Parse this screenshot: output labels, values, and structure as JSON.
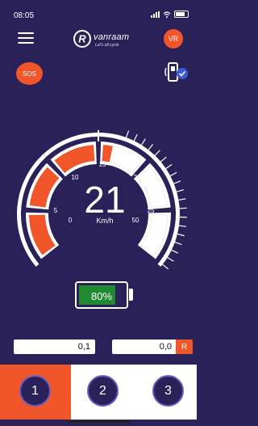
{
  "status": {
    "time": "08:05"
  },
  "header": {
    "brand": "vanraam",
    "tagline": "Let's all cycle",
    "avatar_initials": "VR"
  },
  "actions": {
    "sos_label": "SOS"
  },
  "gauge": {
    "speed": "21",
    "unit": "Km/h",
    "ticks": [
      "0",
      "5",
      "10",
      "15",
      "20",
      "25",
      "50"
    ],
    "speed_value": 21,
    "accent_color": "#f1552a"
  },
  "battery": {
    "percent_label": "80%",
    "level": 0.8,
    "fill_color": "#1f8a2f"
  },
  "odometers": {
    "left_value": "0,1",
    "right_value": "0,0",
    "reset_label": "R"
  },
  "modes": {
    "items": [
      "1",
      "2",
      "3"
    ],
    "active_index": 0
  },
  "colors": {
    "background": "#2a2158",
    "accent": "#f1552a"
  }
}
